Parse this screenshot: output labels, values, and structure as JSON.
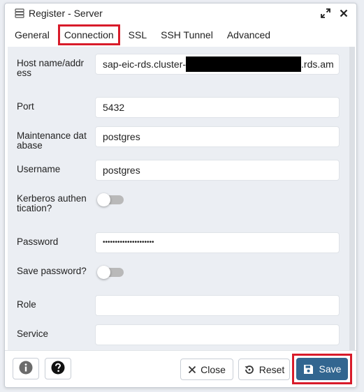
{
  "dialog": {
    "title": "Register - Server",
    "icons": {
      "server": "server-icon",
      "expand": "expand-icon",
      "close": "close-icon"
    }
  },
  "tabs": [
    {
      "label": "General",
      "active": false
    },
    {
      "label": "Connection",
      "active": true
    },
    {
      "label": "SSL",
      "active": false
    },
    {
      "label": "SSH Tunnel",
      "active": false
    },
    {
      "label": "Advanced",
      "active": false
    }
  ],
  "form": {
    "host_label": "Host name/address",
    "host_value_start": "sap-eic-rds.cluster-",
    "host_value_end": ".rds.am",
    "port_label": "Port",
    "port_value": "5432",
    "maintenance_label": "Maintenance database",
    "maintenance_value": "postgres",
    "username_label": "Username",
    "username_value": "postgres",
    "kerberos_label": "Kerberos authentication?",
    "kerberos_on": false,
    "password_label": "Password",
    "password_value": "•••••••••••••••••••••",
    "save_password_label": "Save password?",
    "save_password_on": false,
    "role_label": "Role",
    "role_value": "",
    "service_label": "Service",
    "service_value": ""
  },
  "footer": {
    "info_icon": "info-icon",
    "help_icon": "help-icon",
    "close_label": "Close",
    "reset_label": "Reset",
    "save_label": "Save"
  },
  "colors": {
    "accent": "#326690",
    "highlight": "#d81b2a",
    "panel_bg": "#ebeef3"
  }
}
